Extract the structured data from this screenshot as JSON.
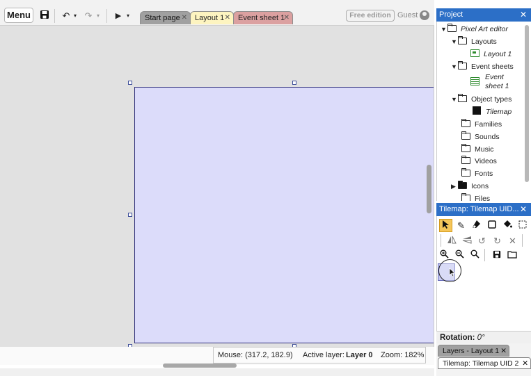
{
  "toolbar": {
    "menu_label": "Menu",
    "icons": [
      "save-icon",
      "undo-icon",
      "redo-icon",
      "play-icon"
    ]
  },
  "tabs": [
    {
      "label": "Start page",
      "state": "inactive"
    },
    {
      "label": "Layout 1",
      "state": "active"
    },
    {
      "label": "Event sheet 1",
      "state": "inactive"
    }
  ],
  "account": {
    "edition_label": "Free edition",
    "user_label": "Guest"
  },
  "status": {
    "mouse_label": "Mouse: (317.2, 182.9)",
    "active_layer_prefix": "Active layer:",
    "active_layer_value": "Layer 0",
    "zoom_label": "Zoom: 182%"
  },
  "project": {
    "title": "Project",
    "tree": {
      "root": "Pixel Art editor",
      "layouts": "Layouts",
      "layout_1": "Layout 1",
      "event_sheets": "Event sheets",
      "event_sheet_1_line1": "Event",
      "event_sheet_1_line2": "sheet 1",
      "object_types": "Object types",
      "tilemap": "Tilemap",
      "families": "Families",
      "sounds": "Sounds",
      "music": "Music",
      "videos": "Videos",
      "fonts": "Fonts",
      "icons": "Icons",
      "files": "Files"
    }
  },
  "tilemap_panel": {
    "title": "Tilemap: Tilemap UID...",
    "rotation_label": "Rotation:",
    "rotation_value": "0°"
  },
  "bottom_tabs": [
    {
      "label": "Layers - Layout 1"
    },
    {
      "label": "Tilemap: Tilemap UID 2"
    }
  ],
  "colors": {
    "accent": "#2c6fc7",
    "layout_fill": "#dcdcfa",
    "active_tool": "#f5c65a",
    "tab_layout": "#fdf4c0",
    "tab_event": "#dba0a0"
  }
}
